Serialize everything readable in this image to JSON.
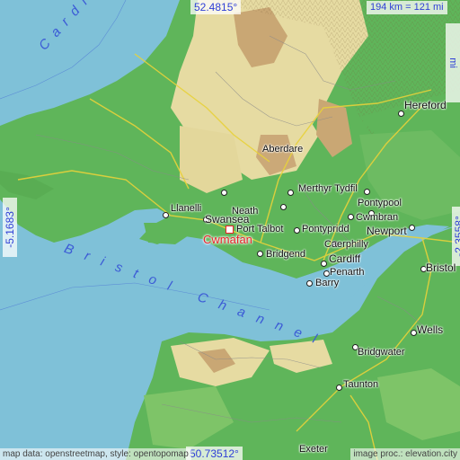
{
  "coords": {
    "north": "52.4815°",
    "south": "50.73512°",
    "west": "-5.1683°",
    "east": "-2.3558°"
  },
  "scale": {
    "label": "194 km = 121 mi"
  },
  "highlight_place": "Cwmafan",
  "places": [
    {
      "name": "Hereford",
      "big": true
    },
    {
      "name": "Neath",
      "big": false
    },
    {
      "name": "Aberdare",
      "big": false
    },
    {
      "name": "Merthyr Tydfil",
      "big": false
    },
    {
      "name": "Pontypool",
      "big": false
    },
    {
      "name": "Cwmbran",
      "big": false
    },
    {
      "name": "Llanelli",
      "big": false
    },
    {
      "name": "Swansea",
      "big": true
    },
    {
      "name": "Port Talbot",
      "big": false
    },
    {
      "name": "Pontypridd",
      "big": false
    },
    {
      "name": "Newport",
      "big": true
    },
    {
      "name": "Caerphilly",
      "big": false
    },
    {
      "name": "Bridgend",
      "big": false
    },
    {
      "name": "Cardiff",
      "big": true
    },
    {
      "name": "Penarth",
      "big": false
    },
    {
      "name": "Barry",
      "big": false
    },
    {
      "name": "Bristol",
      "big": true
    },
    {
      "name": "Wells",
      "big": true
    },
    {
      "name": "Bridgwater",
      "big": false
    },
    {
      "name": "Taunton",
      "big": false
    },
    {
      "name": "Exeter",
      "big": false
    }
  ],
  "water": {
    "cardigan": "Cardigan",
    "channel": "Bristol Channel"
  },
  "credits": {
    "left": "map data: openstreetmap, style: opentopomap",
    "right": "image proc.: elevation.city"
  },
  "colors": {
    "sea": "#7fc1d8",
    "lowland": "#5fb55a",
    "upland": "#e6dba2",
    "highland": "#c9a774",
    "accent": "#e8232a",
    "label_blue": "#2f3fd6"
  }
}
